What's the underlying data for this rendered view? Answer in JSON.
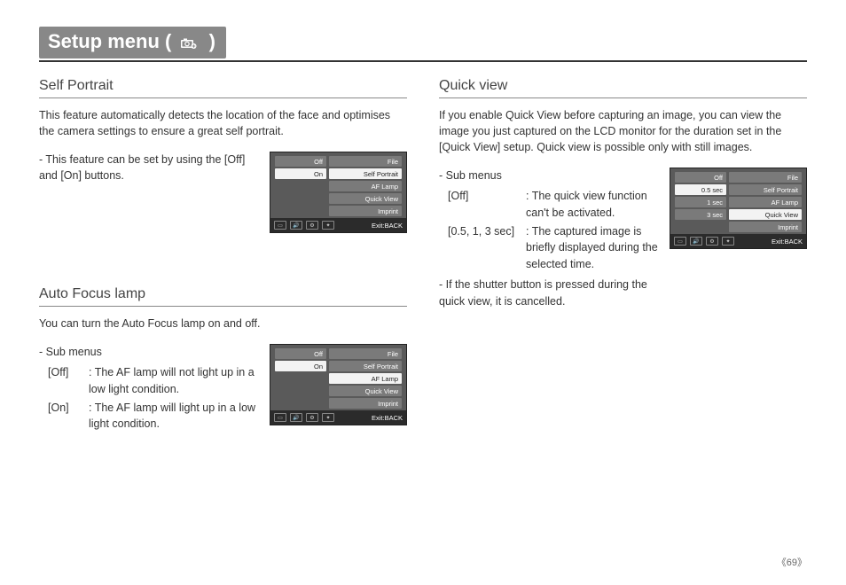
{
  "page_title_prefix": "Setup menu (",
  "page_title_suffix": ")",
  "page_number": "69",
  "left": {
    "sec1": {
      "head": "Self Portrait",
      "intro": "This feature automatically detects the location of the face and optimises the camera settings to ensure a great self portrait.",
      "note": "- This feature can be set by using the [Off] and [On] buttons."
    },
    "sec2": {
      "head": "Auto Focus lamp",
      "intro": "You can turn the Auto Focus lamp on and off.",
      "sub_label": "- Sub menus",
      "rows": [
        {
          "k": "[Off]",
          "v": ": The AF lamp will not light up in a low light condition."
        },
        {
          "k": "[On]",
          "v": ": The AF lamp will light up in a low light condition."
        }
      ]
    }
  },
  "right": {
    "sec1": {
      "head": "Quick view",
      "intro": "If you enable Quick View before capturing an image, you can view the image you just captured on the LCD monitor for the duration set in the [Quick View] setup. Quick view is possible only with still images.",
      "sub_label": "- Sub menus",
      "rows": [
        {
          "k": "[Off]",
          "v": ": The quick view function can't be activated."
        },
        {
          "k": "[0.5, 1, 3 sec]",
          "v": ": The captured image is briefly displayed during the selected time."
        }
      ],
      "after": "- If the shutter button is pressed during the quick view, it is cancelled."
    }
  },
  "screens": {
    "common_right_labels": [
      "File",
      "Self Portrait",
      "AF Lamp",
      "Quick View",
      "Imprint"
    ],
    "exit": "Exit:BACK",
    "s1_left": [
      "Off",
      "On",
      "",
      "",
      ""
    ],
    "s1_active_left": 1,
    "s1_active_right": 1,
    "s2_left": [
      "Off",
      "On",
      "",
      "",
      ""
    ],
    "s2_active_left": 1,
    "s2_active_right": 2,
    "s3_left": [
      "Off",
      "0.5 sec",
      "1 sec",
      "3 sec",
      ""
    ],
    "s3_active_left": 1,
    "s3_active_right": 3
  }
}
